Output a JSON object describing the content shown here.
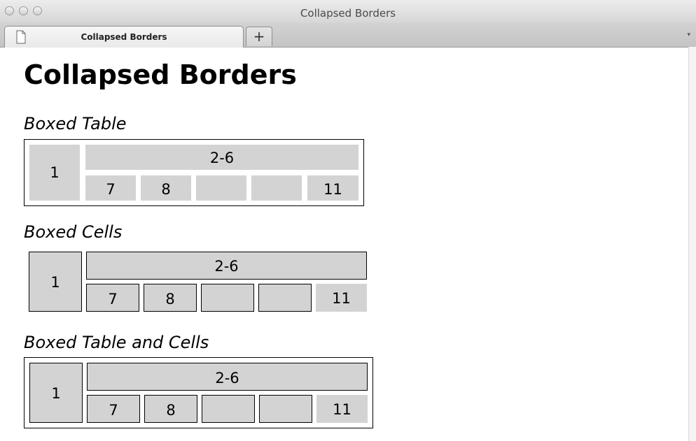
{
  "window": {
    "title": "Collapsed Borders"
  },
  "tabbar": {
    "active_tab": "Collapsed Borders",
    "new_tab_label": "+",
    "menu_arrow": "▾"
  },
  "page": {
    "heading": "Collapsed Borders",
    "sections": [
      {
        "title": "Boxed Table",
        "cells": {
          "rowspan": "1",
          "colspan": "2-6",
          "row2": [
            "7",
            "8",
            "",
            "",
            "11"
          ]
        }
      },
      {
        "title": "Boxed Cells",
        "cells": {
          "rowspan": "1",
          "colspan": "2-6",
          "row2": [
            "7",
            "8",
            "",
            "",
            "11"
          ]
        }
      },
      {
        "title": "Boxed Table and Cells",
        "cells": {
          "rowspan": "1",
          "colspan": "2-6",
          "row2": [
            "7",
            "8",
            "",
            "",
            "11"
          ]
        }
      }
    ]
  },
  "colors": {
    "cell_background": "#d3d3d3",
    "border": "#000000"
  }
}
